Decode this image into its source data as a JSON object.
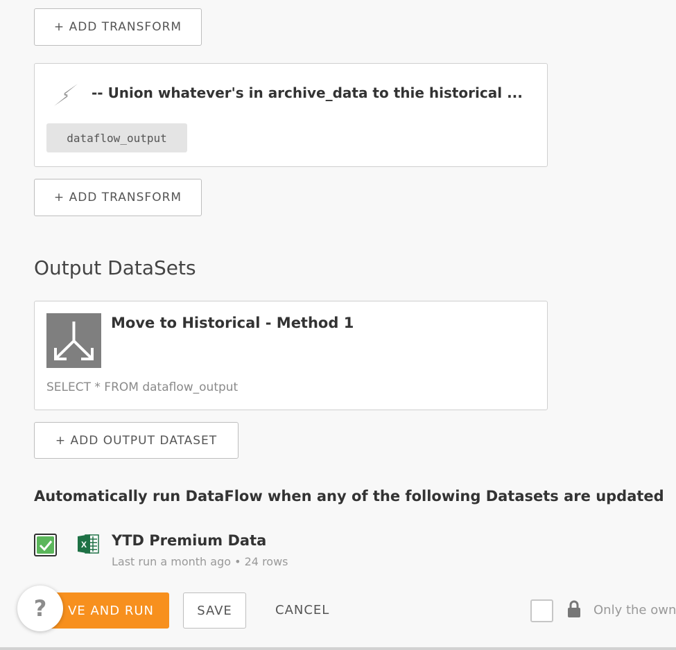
{
  "transforms": {
    "add_transform_label_1": "+ ADD TRANSFORM",
    "add_transform_label_2": "+ ADD TRANSFORM",
    "transform_card": {
      "title": "-- Union whatever's in archive_data to thie historical ...",
      "output_chip": "dataflow_output",
      "icon": "lightning-bolt-icon"
    }
  },
  "outputs": {
    "section_title": "Output DataSets",
    "dataset_card": {
      "title": "Move to Historical - Method 1",
      "sql": "SELECT * FROM dataflow_output",
      "icon": "merge-arrows-icon"
    },
    "add_output_label": "+ ADD OUTPUT DATASET"
  },
  "triggers": {
    "heading": "Automatically run DataFlow when any of the following Datasets are updated",
    "datasets": [
      {
        "name": "YTD Premium Data",
        "meta": "Last run a month ago • 24 rows",
        "checked": true,
        "icon": "excel-icon"
      }
    ]
  },
  "footer": {
    "save_and_run_visible": "VE AND RUN",
    "save_label": "SAVE",
    "cancel_label": "CANCEL",
    "owner_only_label": "Only the own",
    "help_label": "?"
  },
  "colors": {
    "primary": "#f7901e",
    "check_green": "#5bb65b",
    "excel_green": "#1e7145",
    "icon_gray": "#7f7f7f"
  }
}
